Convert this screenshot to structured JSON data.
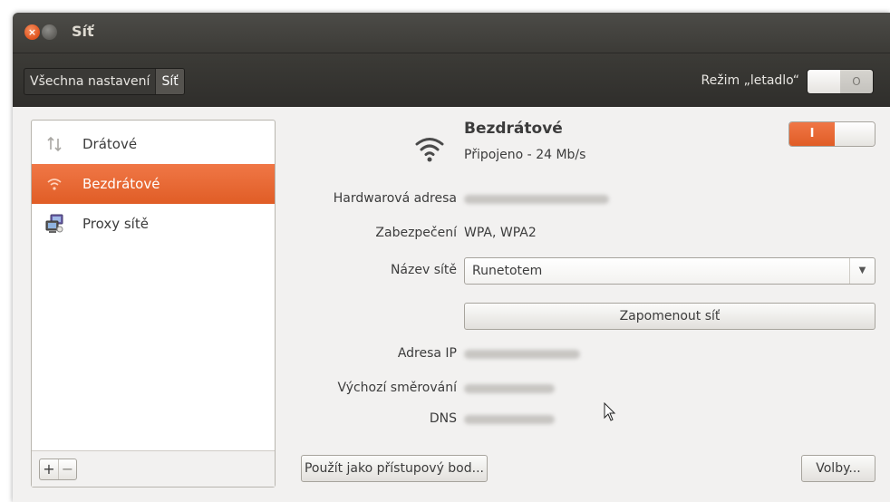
{
  "window": {
    "title": "Síť",
    "close_icon": "×"
  },
  "toolbar": {
    "breadcrumb_all": "Všechna nastavení",
    "breadcrumb_current": "Síť",
    "airplane_label": "Režim „letadlo“",
    "airplane_switch_off_label": "O",
    "airplane_mode": false
  },
  "sidebar": {
    "items": [
      {
        "label": "Drátové",
        "icon": "wired-arrows-icon"
      },
      {
        "label": "Bezdrátové",
        "icon": "wifi-icon",
        "selected": true
      },
      {
        "label": "Proxy sítě",
        "icon": "proxy-computers-icon"
      }
    ],
    "add_label": "+",
    "remove_label": "−"
  },
  "panel": {
    "title": "Bezdrátové",
    "status": "Připojeno - 24 Mb/s",
    "toggle_on_label": "I",
    "fields": {
      "hw_label": "Hardwarová adresa",
      "security_label": "Zabezpečení",
      "security_value": "WPA, WPA2",
      "network_label": "Název sítě",
      "network_value": "Runetotem",
      "ip_label": "Adresa IP",
      "gateway_label": "Výchozí směrování",
      "dns_label": "DNS"
    },
    "forget_button": "Zapomenout síť",
    "hotspot_button": "Použít jako přístupový bod...",
    "options_button": "Volby..."
  },
  "colors": {
    "accent": "#e8662f",
    "titlebar": "#3c3b37",
    "window_bg": "#f2f1f0"
  }
}
